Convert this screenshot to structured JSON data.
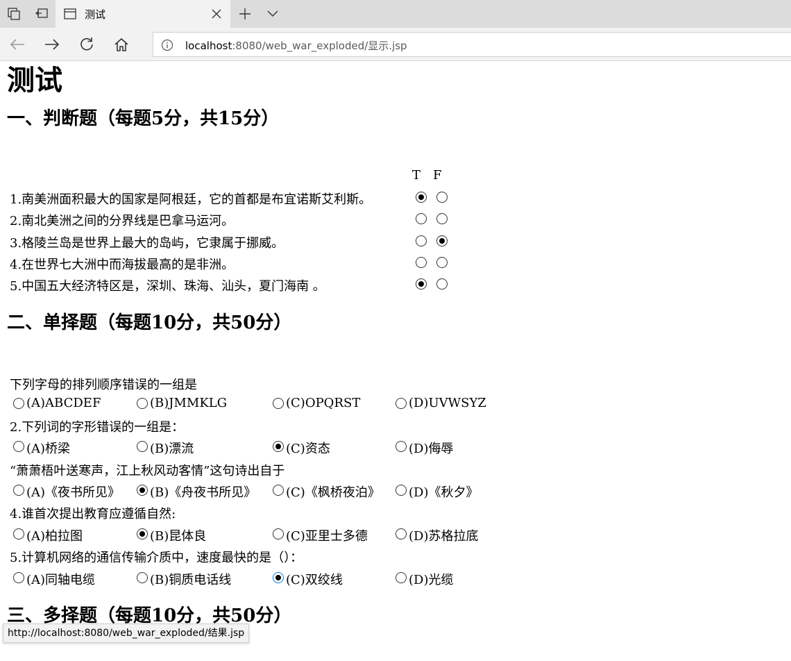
{
  "browser": {
    "tab_title": "测试",
    "url_host": "localhost",
    "url_path": ":8080/web_war_exploded/显示.jsp",
    "status_url": "http://localhost:8080/web_war_exploded/结果.jsp"
  },
  "page": {
    "title": "测试",
    "section1_title": "一、判断题（每题5分，共15分）",
    "section2_title": "二、单择题（每题10分，共50分）",
    "section3_title": "三、多择题（每题10分，共50分）"
  },
  "tf": {
    "header_t": "T",
    "header_f": "F",
    "questions": [
      {
        "text": "1.南美洲面积最大的国家是阿根廷，它的首都是布宜诺斯艾利斯。",
        "answer": "T"
      },
      {
        "text": "2.南北美洲之间的分界线是巴拿马运河。",
        "answer": ""
      },
      {
        "text": "3.格陵兰岛是世界上最大的岛屿，它隶属于挪威。",
        "answer": "F"
      },
      {
        "text": "4.在世界七大洲中而海拔最高的是非洲。",
        "answer": ""
      },
      {
        "text": "5.中国五大经济特区是，深圳、珠海、汕头，夏门海南 。",
        "answer": "T"
      }
    ]
  },
  "single": {
    "questions": [
      {
        "text": "下列字母的排列顺序错误的一组是",
        "options": [
          "(A)ABCDEF",
          "(B)JMMKLG",
          "(C)OPQRST",
          "(D)UVWSYZ"
        ],
        "selected": -1
      },
      {
        "text": "2.下列词的字形错误的一组是：",
        "options": [
          "(A)桥梁",
          "(B)漂流",
          "(C)资态",
          "(D)侮辱"
        ],
        "selected": 2
      },
      {
        "text": "“萧萧梧叶送寒声，江上秋风动客情”这句诗出自于",
        "options": [
          "(A)《夜书所见》",
          "(B)《舟夜书所见》",
          "(C)《枫桥夜泊》",
          "(D)《秋夕》"
        ],
        "selected": 1
      },
      {
        "text": "4.谁首次提出教育应遵循自然:",
        "options": [
          "(A)柏拉图",
          "(B)昆体良",
          "(C)亚里士多德",
          "(D)苏格拉底"
        ],
        "selected": 1
      },
      {
        "text": "5.计算机网络的通信传输介质中，速度最快的是（）：",
        "options": [
          "(A)同轴电缆",
          "(B)铜质电话线",
          "(C)双绞线",
          "(D)光缆"
        ],
        "selected": 2
      }
    ]
  }
}
